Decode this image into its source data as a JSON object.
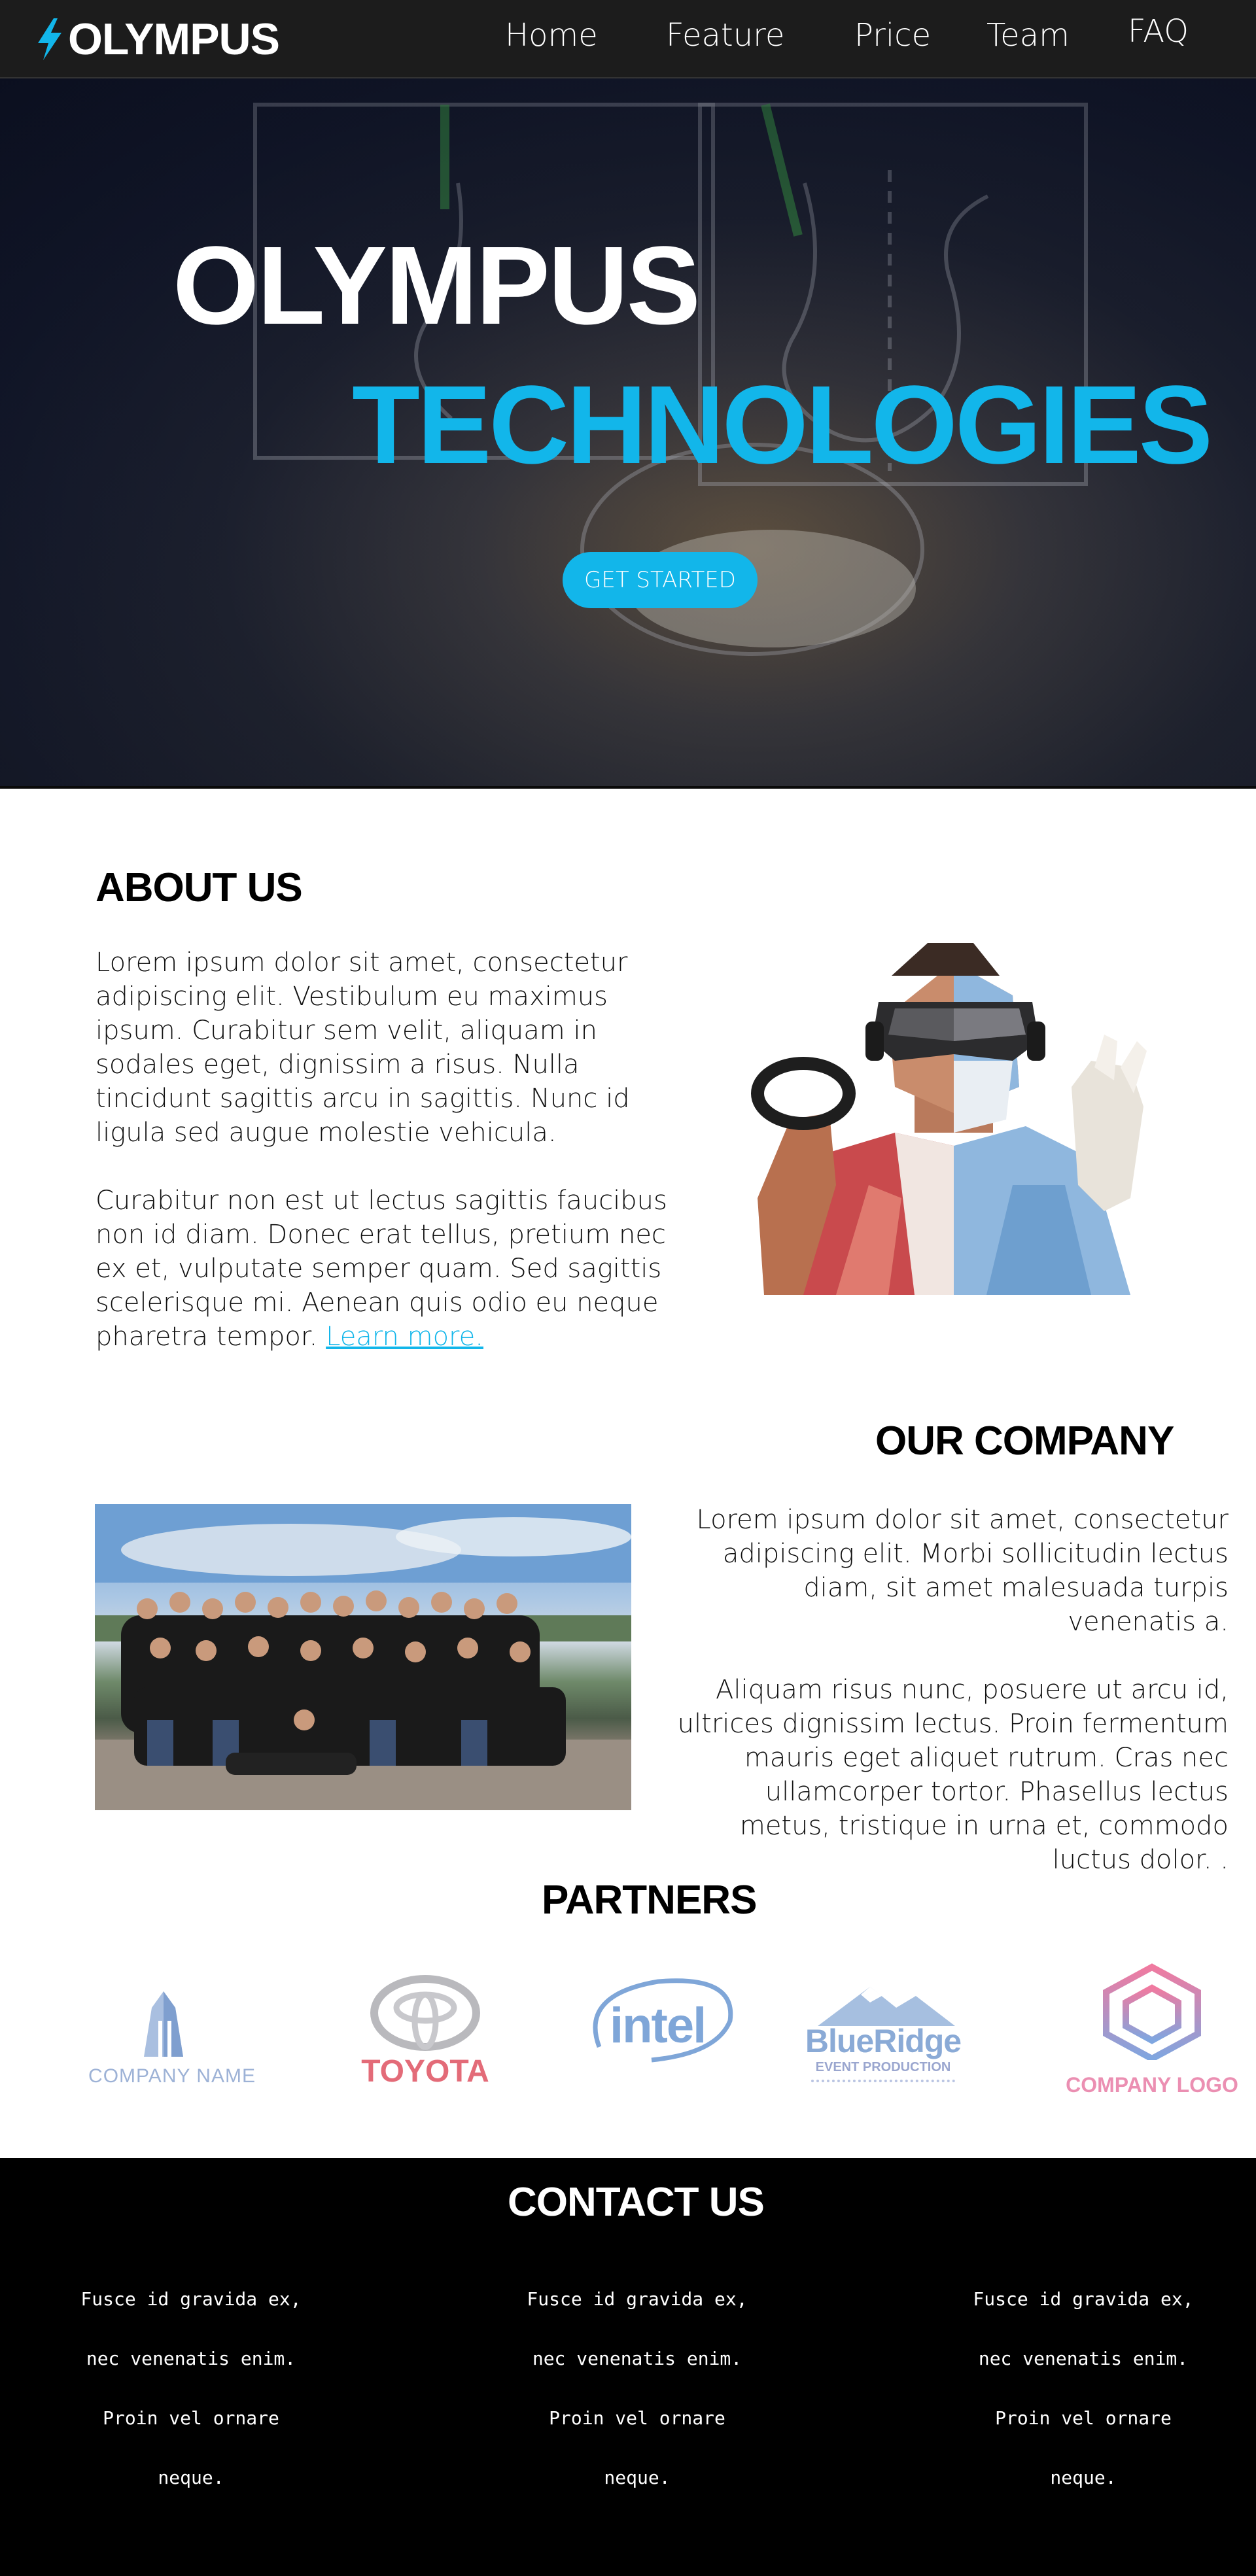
{
  "brand": {
    "name": "OLYMPUS"
  },
  "nav": {
    "items": [
      "Home",
      "Feature",
      "Price",
      "Team",
      "FAQ"
    ]
  },
  "hero": {
    "title_line1": "OLYMPUS",
    "title_line2": "TECHNOLOGIES",
    "cta_label": "GET STARTED"
  },
  "about": {
    "heading": "ABOUT US",
    "paragraph1": "Lorem ipsum dolor sit amet, consectetur adipiscing elit. Vestibulum eu maximus ipsum. Curabitur sem velit, aliquam in sodales eget, dignissim a risus. Nulla tincidunt sagittis arcu in sagittis. Nunc id ligula sed augue molestie vehicula.",
    "paragraph2": "Curabitur non est ut lectus sagittis faucibus non id diam. Donec erat tellus, pretium nec ex et, vulputate semper quam. Sed sagittis scelerisque mi. Aenean quis odio eu neque pharetra tempor. ",
    "link_label": "Learn more."
  },
  "company": {
    "heading": "OUR COMPANY",
    "paragraph1": "Lorem ipsum dolor sit amet, consectetur adipiscing elit. Morbi sollicitudin lectus diam, sit amet malesuada turpis venenatis a.",
    "paragraph2": "Aliquam risus nunc, posuere ut arcu id, ultrices dignissim lectus. Proin fermentum mauris eget aliquet rutrum. Cras nec ullamcorper tortor. Phasellus lectus metus, tristique in urna et, commodo luctus dolor. ."
  },
  "partners": {
    "heading": "PARTNERS",
    "logos": [
      {
        "name": "COMPANY NAME"
      },
      {
        "name": "TOYOTA"
      },
      {
        "name": "intel"
      },
      {
        "name": "BlueRidge",
        "sub": "EVENT PRODUCTION"
      },
      {
        "name": "COMPANY LOGO"
      }
    ]
  },
  "contact": {
    "heading": "CONTACT US",
    "columns": [
      {
        "lines": [
          "Fusce id gravida ex,",
          "nec venenatis enim.",
          "Proin vel ornare",
          "neque."
        ]
      },
      {
        "lines": [
          "Fusce id gravida ex,",
          "nec venenatis enim.",
          "Proin vel ornare",
          "neque."
        ]
      },
      {
        "lines": [
          "Fusce id gravida ex,",
          "nec venenatis enim.",
          "Proin vel ornare",
          "neque."
        ]
      }
    ]
  },
  "colors": {
    "accent": "#12b6ea",
    "nav_bg": "#1c1c1c",
    "footer_bg": "#000000",
    "toyota_red": "#e36b78",
    "intel_blue": "#7fa6d8"
  }
}
